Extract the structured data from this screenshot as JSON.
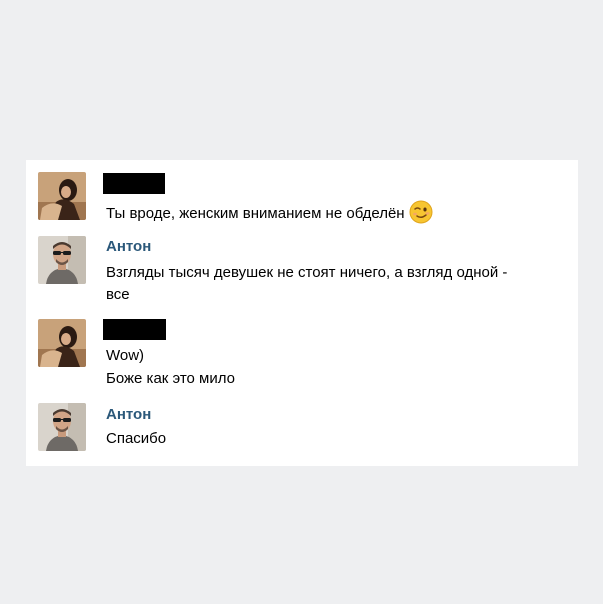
{
  "conversation": {
    "messages": [
      {
        "sender": "",
        "sender_redacted": true,
        "avatar": "woman-photo-avatar",
        "lines": [
          "Ты вроде, женским вниманием не обделён"
        ],
        "emoji": "winking-face-emoji"
      },
      {
        "sender": "Антон",
        "sender_redacted": false,
        "avatar": "man-sunglasses-photo-avatar",
        "lines": [
          "Взгляды тысяч девушек не стоят ничего, а взгляд одной -",
          "все"
        ]
      },
      {
        "sender": "",
        "sender_redacted": true,
        "avatar": "woman-photo-avatar",
        "lines": [
          "Wow)",
          "Боже как это мило"
        ]
      },
      {
        "sender": "Антон",
        "sender_redacted": false,
        "avatar": "man-sunglasses-photo-avatar",
        "lines": [
          "Спасибо"
        ]
      }
    ]
  },
  "colors": {
    "background": "#eeeff1",
    "panel": "#ffffff",
    "sender_name": "#2b587a",
    "message_text": "#000000",
    "redaction": "#000000"
  }
}
